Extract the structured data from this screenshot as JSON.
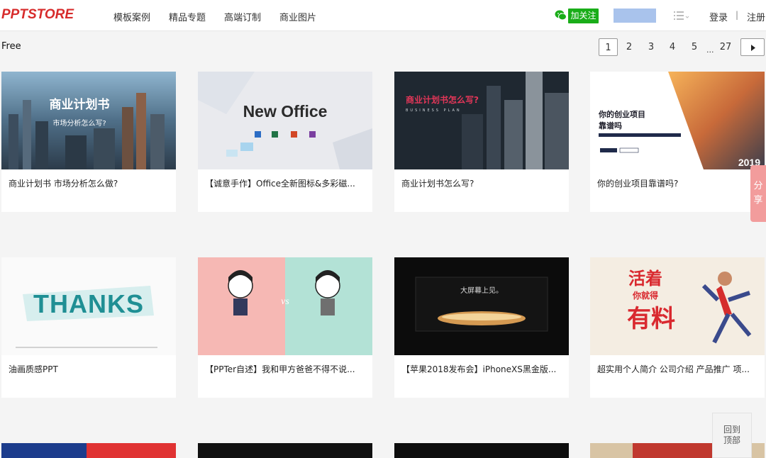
{
  "header": {
    "logo": "PPTSTORE",
    "nav": [
      "模板案例",
      "精品专题",
      "高端订制",
      "商业图片"
    ],
    "follow_label": "加关注",
    "login": "登录",
    "separator": "|",
    "register": "注册"
  },
  "filter_label": "Free",
  "pagination": {
    "pages": [
      "1",
      "2",
      "3",
      "4",
      "5",
      "27"
    ],
    "current": "1",
    "ellipsis": "..."
  },
  "cards": [
    {
      "title": "商业计划书 市场分析怎么做?",
      "thumb_text": [
        "商业计划书",
        "市场分析怎么写?"
      ]
    },
    {
      "title": "【诚意手作】Office全新图标&多彩磁...",
      "thumb_text": [
        "New Office"
      ]
    },
    {
      "title": "商业计划书怎么写?",
      "thumb_text": [
        "商业计划书怎么写?",
        "BUSINESS PLAN"
      ]
    },
    {
      "title": "你的创业项目靠谱吗?",
      "thumb_text": [
        "你的创业项目",
        "靠谱吗",
        "2019"
      ]
    },
    {
      "title": "油画质感PPT",
      "thumb_text": [
        "THANKS"
      ]
    },
    {
      "title": "【PPTer自述】我和甲方爸爸不得不说...",
      "thumb_text": [
        "vs"
      ]
    },
    {
      "title": "【苹果2018发布会】iPhoneXS黑金版...",
      "thumb_text": [
        "大屏幕上见。"
      ]
    },
    {
      "title": "超实用个人简介 公司介绍 产品推广 项...",
      "thumb_text": [
        "活着",
        "你就得",
        "有料"
      ]
    }
  ],
  "share_label": [
    "分",
    "享"
  ],
  "back_to_top": [
    "回到",
    "顶部"
  ],
  "colors": {
    "brand": "#d72b2b",
    "follow_green": "#1aad19",
    "share_pink": "#f29c9c"
  },
  "icons": [
    "wechat-icon",
    "list-icon",
    "chevron-right-icon"
  ]
}
